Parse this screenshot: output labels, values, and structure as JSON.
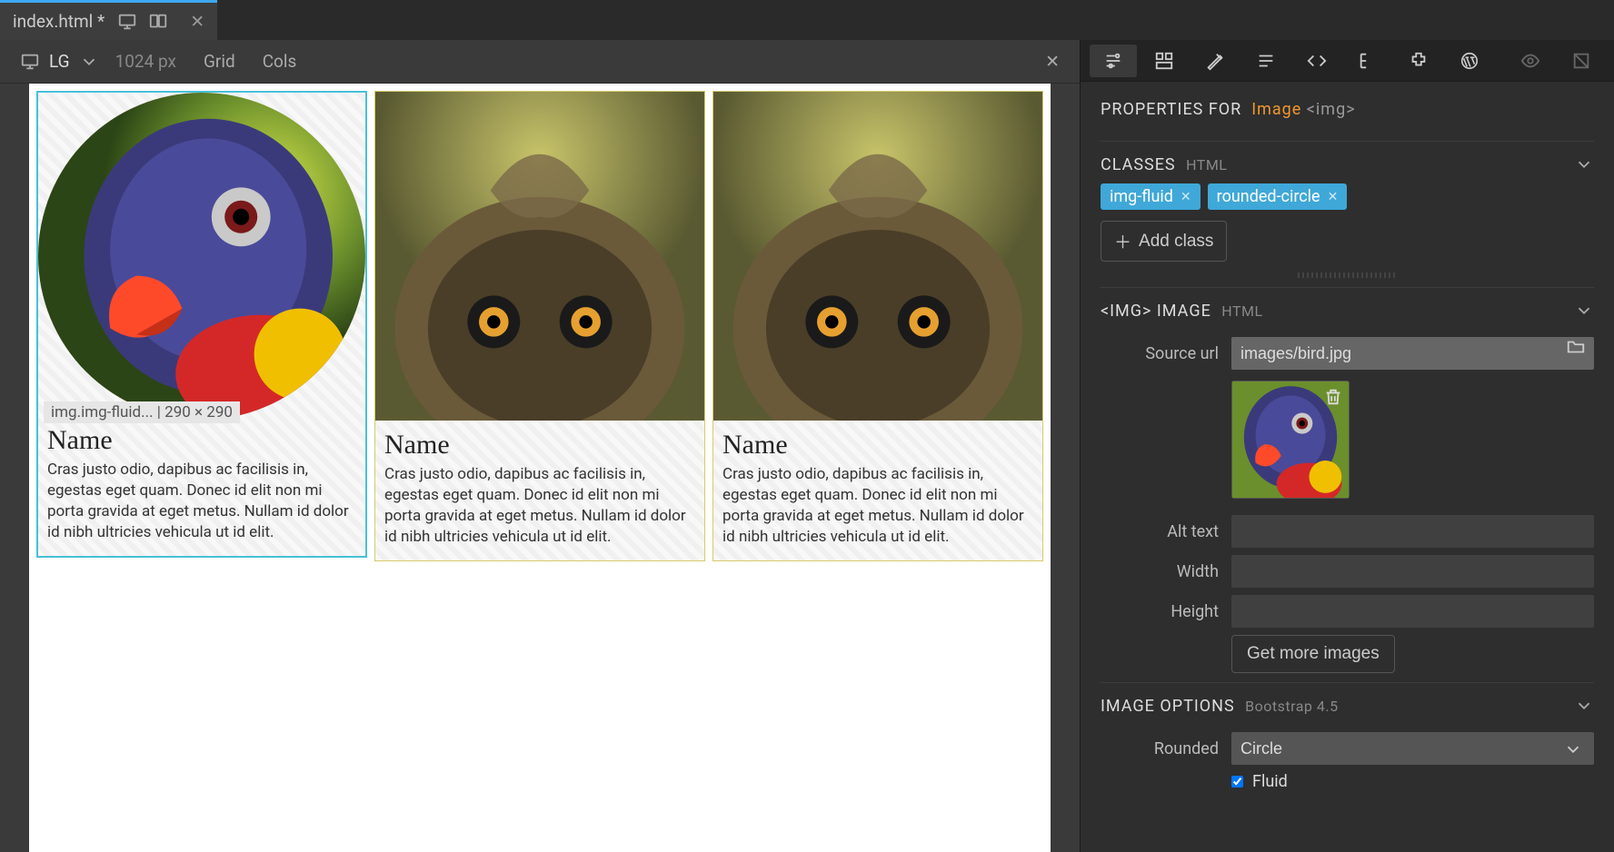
{
  "tab": {
    "title": "index.html *"
  },
  "breakpoint": {
    "label": "LG",
    "px": "1024 px"
  },
  "toolbar": {
    "grid": "Grid",
    "cols": "Cols"
  },
  "selection_badge": "img.img-fluid... | 290 × 290",
  "cards": [
    {
      "heading": "Name",
      "body": "Cras justo odio, dapibus ac facilisis in, egestas eget quam. Donec id elit non mi porta gravida at eget metus. Nullam id dolor id nibh ultricies vehicula ut id elit."
    },
    {
      "heading": "Name",
      "body": "Cras justo odio, dapibus ac facilisis in, egestas eget quam. Donec id elit non mi porta gravida at eget metus. Nullam id dolor id nibh ultricies vehicula ut id elit."
    },
    {
      "heading": "Name",
      "body": "Cras justo odio, dapibus ac facilisis in, egestas eget quam. Donec id elit non mi porta gravida at eget metus. Nullam id dolor id nibh ultricies vehicula ut id elit."
    }
  ],
  "panel": {
    "title_prefix": "PROPERTIES FOR",
    "title_element": "Image",
    "title_tag": "<img>",
    "classes_head": "CLASSES",
    "classes_sub": "HTML",
    "classes": [
      "img-fluid",
      "rounded-circle"
    ],
    "add_class": "Add class",
    "img_head": "<IMG> IMAGE",
    "img_sub": "HTML",
    "src_label": "Source url",
    "src_value": "images/bird.jpg",
    "alt_label": "Alt text",
    "alt_value": "",
    "width_label": "Width",
    "width_value": "",
    "height_label": "Height",
    "height_value": "",
    "get_more": "Get more images",
    "opts_head": "IMAGE OPTIONS",
    "opts_sub": "Bootstrap 4.5",
    "rounded_label": "Rounded",
    "rounded_value": "Circle",
    "fluid_label": "Fluid",
    "fluid_checked": true
  }
}
